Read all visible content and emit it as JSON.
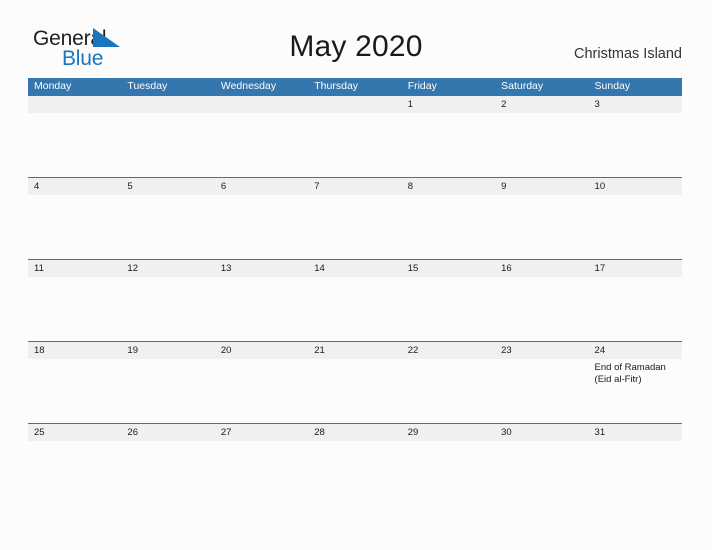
{
  "brand": {
    "name_line1": "General",
    "name_line2": "Blue",
    "logo_mark_icon": "blue-flag-triangle-icon",
    "colors": {
      "text_dark": "#231f20",
      "blue": "#1b75bb"
    }
  },
  "header": {
    "month_title": "May 2020",
    "region": "Christmas Island"
  },
  "colors": {
    "header_blue": "#3476ae",
    "date_band_gray": "#f0f0f0",
    "page_background": "#fcfcfc",
    "text": "#1a1a1a"
  },
  "calendar": {
    "weekdays": [
      "Monday",
      "Tuesday",
      "Wednesday",
      "Thursday",
      "Friday",
      "Saturday",
      "Sunday"
    ],
    "weeks": [
      {
        "days": [
          {
            "date": "",
            "events": []
          },
          {
            "date": "",
            "events": []
          },
          {
            "date": "",
            "events": []
          },
          {
            "date": "",
            "events": []
          },
          {
            "date": "1",
            "events": []
          },
          {
            "date": "2",
            "events": []
          },
          {
            "date": "3",
            "events": []
          }
        ]
      },
      {
        "days": [
          {
            "date": "4",
            "events": []
          },
          {
            "date": "5",
            "events": []
          },
          {
            "date": "6",
            "events": []
          },
          {
            "date": "7",
            "events": []
          },
          {
            "date": "8",
            "events": []
          },
          {
            "date": "9",
            "events": []
          },
          {
            "date": "10",
            "events": []
          }
        ]
      },
      {
        "days": [
          {
            "date": "11",
            "events": []
          },
          {
            "date": "12",
            "events": []
          },
          {
            "date": "13",
            "events": []
          },
          {
            "date": "14",
            "events": []
          },
          {
            "date": "15",
            "events": []
          },
          {
            "date": "16",
            "events": []
          },
          {
            "date": "17",
            "events": []
          }
        ]
      },
      {
        "days": [
          {
            "date": "18",
            "events": []
          },
          {
            "date": "19",
            "events": []
          },
          {
            "date": "20",
            "events": []
          },
          {
            "date": "21",
            "events": []
          },
          {
            "date": "22",
            "events": []
          },
          {
            "date": "23",
            "events": []
          },
          {
            "date": "24",
            "events": [
              "End of Ramadan",
              "(Eid al-Fitr)"
            ]
          }
        ]
      },
      {
        "days": [
          {
            "date": "25",
            "events": []
          },
          {
            "date": "26",
            "events": []
          },
          {
            "date": "27",
            "events": []
          },
          {
            "date": "28",
            "events": []
          },
          {
            "date": "29",
            "events": []
          },
          {
            "date": "30",
            "events": []
          },
          {
            "date": "31",
            "events": []
          }
        ]
      }
    ]
  }
}
